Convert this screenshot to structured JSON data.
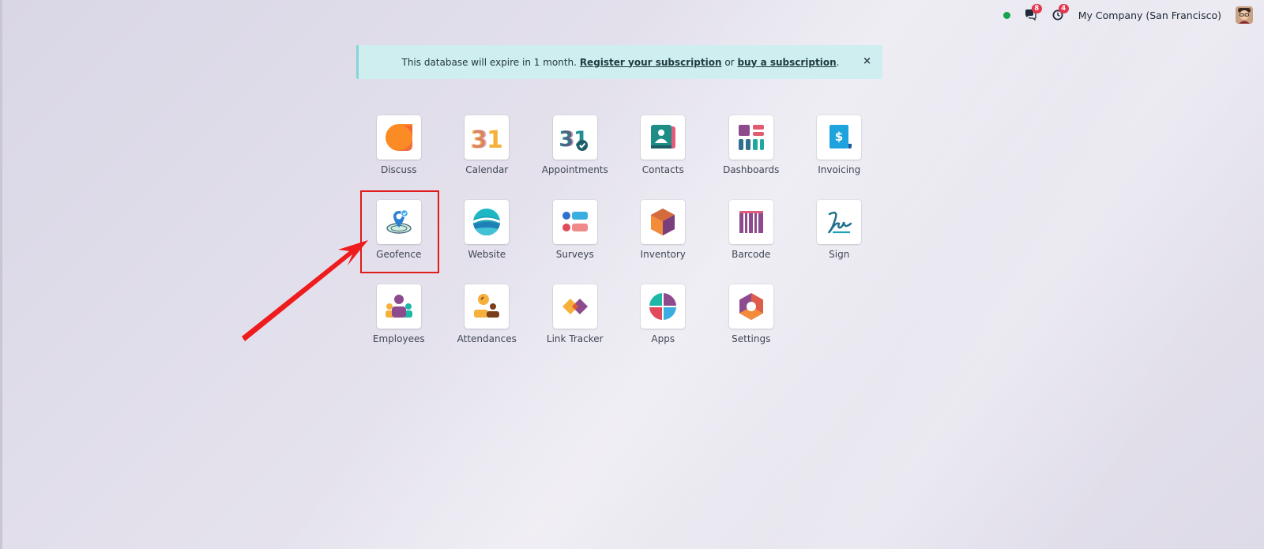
{
  "topbar": {
    "messages_count": "8",
    "activity_count": "4",
    "company": "My Company (San Francisco)"
  },
  "banner": {
    "text_before": "This database will expire in 1 month.",
    "register_link": "Register your subscription",
    "text_mid": "or",
    "buy_link": "buy a subscription",
    "text_after": ".",
    "close": "×"
  },
  "apps": [
    {
      "label": "Discuss"
    },
    {
      "label": "Calendar"
    },
    {
      "label": "Appointments"
    },
    {
      "label": "Contacts"
    },
    {
      "label": "Dashboards"
    },
    {
      "label": "Invoicing"
    },
    {
      "label": "Geofence"
    },
    {
      "label": "Website"
    },
    {
      "label": "Surveys"
    },
    {
      "label": "Inventory"
    },
    {
      "label": "Barcode"
    },
    {
      "label": "Sign"
    },
    {
      "label": "Employees"
    },
    {
      "label": "Attendances"
    },
    {
      "label": "Link Tracker"
    },
    {
      "label": "Apps"
    },
    {
      "label": "Settings"
    }
  ],
  "icons": {
    "calendar_digits": "31",
    "invoice_symbol": "$"
  },
  "colors": {
    "badge": "#e2384d",
    "presence": "#16a34a",
    "banner_bg": "#cfeeef",
    "highlight": "#e01b1b"
  }
}
